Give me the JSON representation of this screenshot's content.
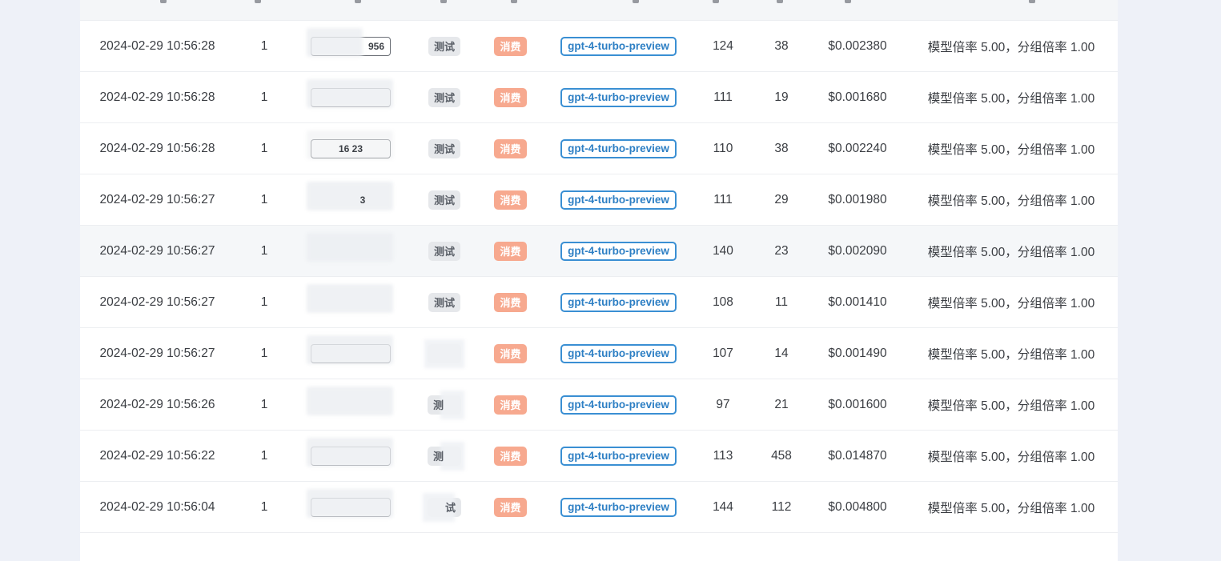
{
  "logs": [
    {
      "time": "2024-02-29 10:56:28",
      "channel": "1",
      "token": "956",
      "group": "测试",
      "type": "消费",
      "model": "gpt-4-turbo-preview",
      "prompt_tokens": "124",
      "completion_tokens": "38",
      "quota": "$0.002380",
      "detail": "模型倍率 5.00，分组倍率 1.00"
    },
    {
      "time": "2024-02-29 10:56:28",
      "channel": "1",
      "token": "",
      "group": "测试",
      "type": "消费",
      "model": "gpt-4-turbo-preview",
      "prompt_tokens": "111",
      "completion_tokens": "19",
      "quota": "$0.001680",
      "detail": "模型倍率 5.00，分组倍率 1.00"
    },
    {
      "time": "2024-02-29 10:56:28",
      "channel": "1",
      "token": "16 23",
      "group": "测试",
      "type": "消费",
      "model": "gpt-4-turbo-preview",
      "prompt_tokens": "110",
      "completion_tokens": "38",
      "quota": "$0.002240",
      "detail": "模型倍率 5.00，分组倍率 1.00"
    },
    {
      "time": "2024-02-29 10:56:27",
      "channel": "1",
      "token": "3",
      "group": "测试",
      "type": "消费",
      "model": "gpt-4-turbo-preview",
      "prompt_tokens": "111",
      "completion_tokens": "29",
      "quota": "$0.001980",
      "detail": "模型倍率 5.00，分组倍率 1.00"
    },
    {
      "time": "2024-02-29 10:56:27",
      "channel": "1",
      "token": "",
      "group": "测试",
      "type": "消费",
      "model": "gpt-4-turbo-preview",
      "prompt_tokens": "140",
      "completion_tokens": "23",
      "quota": "$0.002090",
      "detail": "模型倍率 5.00，分组倍率 1.00"
    },
    {
      "time": "2024-02-29 10:56:27",
      "channel": "1",
      "token": "",
      "group": "测试",
      "type": "消费",
      "model": "gpt-4-turbo-preview",
      "prompt_tokens": "108",
      "completion_tokens": "11",
      "quota": "$0.001410",
      "detail": "模型倍率 5.00，分组倍率 1.00"
    },
    {
      "time": "2024-02-29 10:56:27",
      "channel": "1",
      "token": "",
      "group": "",
      "type": "消费",
      "model": "gpt-4-turbo-preview",
      "prompt_tokens": "107",
      "completion_tokens": "14",
      "quota": "$0.001490",
      "detail": "模型倍率 5.00，分组倍率 1.00"
    },
    {
      "time": "2024-02-29 10:56:26",
      "channel": "1",
      "token": "",
      "group": "测",
      "type": "消费",
      "model": "gpt-4-turbo-preview",
      "prompt_tokens": "97",
      "completion_tokens": "21",
      "quota": "$0.001600",
      "detail": "模型倍率 5.00，分组倍率 1.00"
    },
    {
      "time": "2024-02-29 10:56:22",
      "channel": "1",
      "token": "",
      "group": "测",
      "type": "消费",
      "model": "gpt-4-turbo-preview",
      "prompt_tokens": "113",
      "completion_tokens": "458",
      "quota": "$0.014870",
      "detail": "模型倍率 5.00，分组倍率 1.00"
    },
    {
      "time": "2024-02-29 10:56:04",
      "channel": "1",
      "token": "",
      "group": "试",
      "type": "消费",
      "model": "gpt-4-turbo-preview",
      "prompt_tokens": "144",
      "completion_tokens": "112",
      "quota": "$0.004800",
      "detail": "模型倍率 5.00，分组倍率 1.00"
    }
  ],
  "colors": {
    "page_bg": "#eef1f8",
    "type_tag": "#f7a98f",
    "model_tag": "#3a8fd3",
    "group_tag": "#e6e8eb"
  }
}
